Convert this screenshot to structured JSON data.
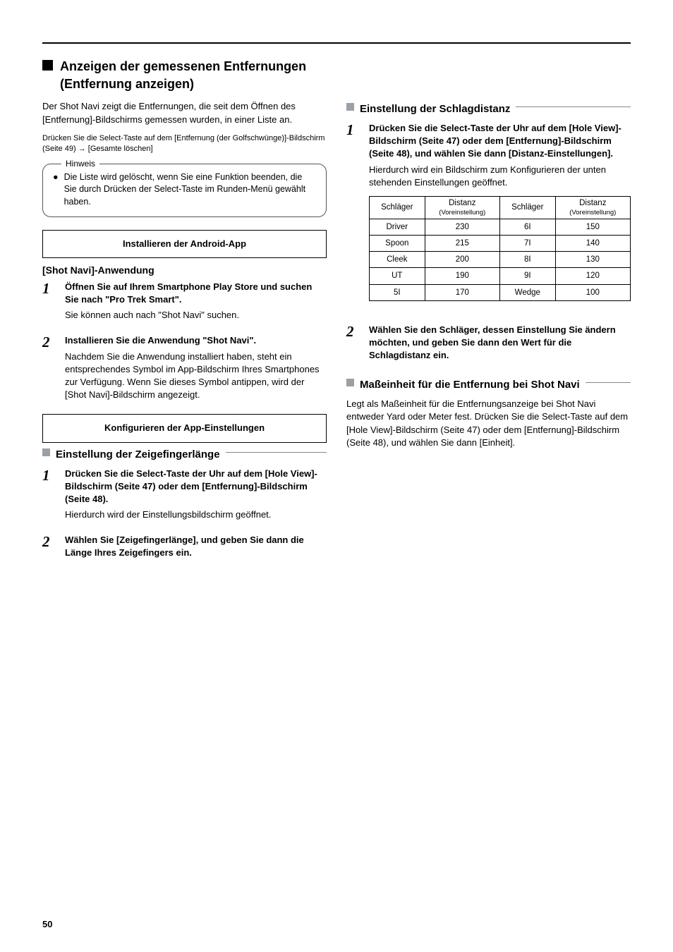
{
  "page_number": "50",
  "left": {
    "h2": "Anzeigen der gemessenen Entfernungen (Entfernung anzeigen)",
    "lead": "Der Shot Navi zeigt die Entfernungen, die seit dem Öffnen des [Entfernung]-Bildschirms gemessen wurden, in einer Liste an.",
    "ref": "Drücken Sie die Select-Taste auf dem [Entfernung (der Golfschwünge)]-Bildschirm (Seite 49) → [Gesamte löschen]",
    "note_title": "Hinweis",
    "note_text": "Die Liste wird gelöscht, wenn Sie eine Funktion beenden, die Sie durch Drücken der Select-Taste im Runden-Menü gewählt haben.",
    "box1": "Installieren der Android-App",
    "box1_sub_title": "[Shot Navi]-Anwendung",
    "step_inst1_num": "1",
    "step_inst1_title": "Öffnen Sie auf Ihrem Smartphone Play Store und suchen Sie nach \"Pro Trek Smart\".",
    "step_inst1_text": "Sie können auch nach \"Shot Navi\" suchen.",
    "step_inst2_num": "2",
    "step_inst2_title": "Installieren Sie die Anwendung \"Shot Navi\".",
    "step_inst2_text": "Nachdem Sie die Anwendung installiert haben, steht ein entsprechendes Symbol im App-Bildschirm Ihres Smartphones zur Verfügung. Wenn Sie dieses Symbol antippen, wird der [Shot Navi]-Bildschirm angezeigt.",
    "box2": "Konfigurieren der App-Einstellungen",
    "sub2_title": "Einstellung der Zeigefingerlänge",
    "step_cfg1_num": "1",
    "step_cfg1_title": "Drücken Sie die Select-Taste der Uhr auf dem [Hole View]-Bildschirm (Seite 47) oder dem [Entfernung]-Bildschirm (Seite 48).",
    "step_cfg1_text": "Hierdurch wird der Einstellungsbildschirm geöffnet.",
    "step_cfg2_num": "2",
    "step_cfg2_title": "Wählen Sie [Zeigefingerlänge], und geben Sie dann die Länge Ihres Zeigefingers ein.",
    "step_cfg2_text": ""
  },
  "right": {
    "sub1_title": "Einstellung der Schlagdistanz",
    "step_r1_num": "1",
    "step_r1_title": "Drücken Sie die Select-Taste der Uhr auf dem [Hole View]-Bildschirm (Seite 47) oder dem [Entfernung]-Bildschirm (Seite 48), und wählen Sie dann [Distanz-Einstellungen].",
    "step_r1_text": "Hierdurch wird ein Bildschirm zum Konfigurieren der unten stehenden Einstellungen geöffnet.",
    "table": {
      "headers": [
        {
          "main": "Schläger",
          "sub": ""
        },
        {
          "main": "Distanz",
          "sub": "(Voreinstellung)"
        },
        {
          "main": "Schläger",
          "sub": ""
        },
        {
          "main": "Distanz",
          "sub": "(Voreinstellung)"
        }
      ],
      "rows": [
        [
          "Driver",
          "230",
          "6I",
          "150"
        ],
        [
          "Spoon",
          "215",
          "7I",
          "140"
        ],
        [
          "Cleek",
          "200",
          "8I",
          "130"
        ],
        [
          "UT",
          "190",
          "9I",
          "120"
        ],
        [
          "5I",
          "170",
          "Wedge",
          "100"
        ]
      ]
    },
    "step_r2_num": "2",
    "step_r2_title": "Wählen Sie den Schläger, dessen Einstellung Sie ändern möchten, und geben Sie dann den Wert für die Schlagdistanz ein.",
    "step_r2_text": "",
    "sub2_title": "Maßeinheit für die Entfernung bei Shot Navi",
    "para2": "Legt als Maßeinheit für die Entfernungsanzeige bei Shot Navi entweder Yard oder Meter fest. Drücken Sie die Select-Taste auf dem [Hole View]-Bildschirm (Seite 47) oder dem [Entfernung]-Bildschirm (Seite 48), und wählen Sie dann [Einheit]."
  }
}
